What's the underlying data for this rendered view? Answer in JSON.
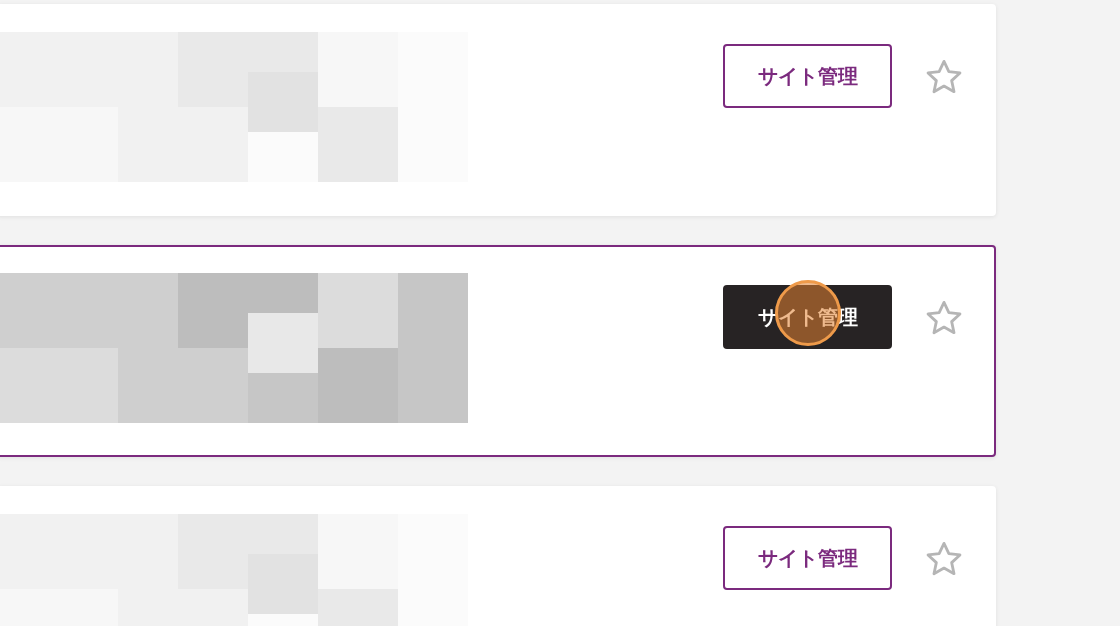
{
  "cards": [
    {
      "selected": false,
      "button": {
        "label": "サイト管理",
        "hovered": false,
        "clicked": false
      },
      "starred": false
    },
    {
      "selected": true,
      "button": {
        "label": "サイト管理",
        "hovered": true,
        "clicked": true
      },
      "starred": false
    },
    {
      "selected": false,
      "button": {
        "label": "サイト管理",
        "hovered": false,
        "clicked": false
      },
      "starred": false
    }
  ]
}
